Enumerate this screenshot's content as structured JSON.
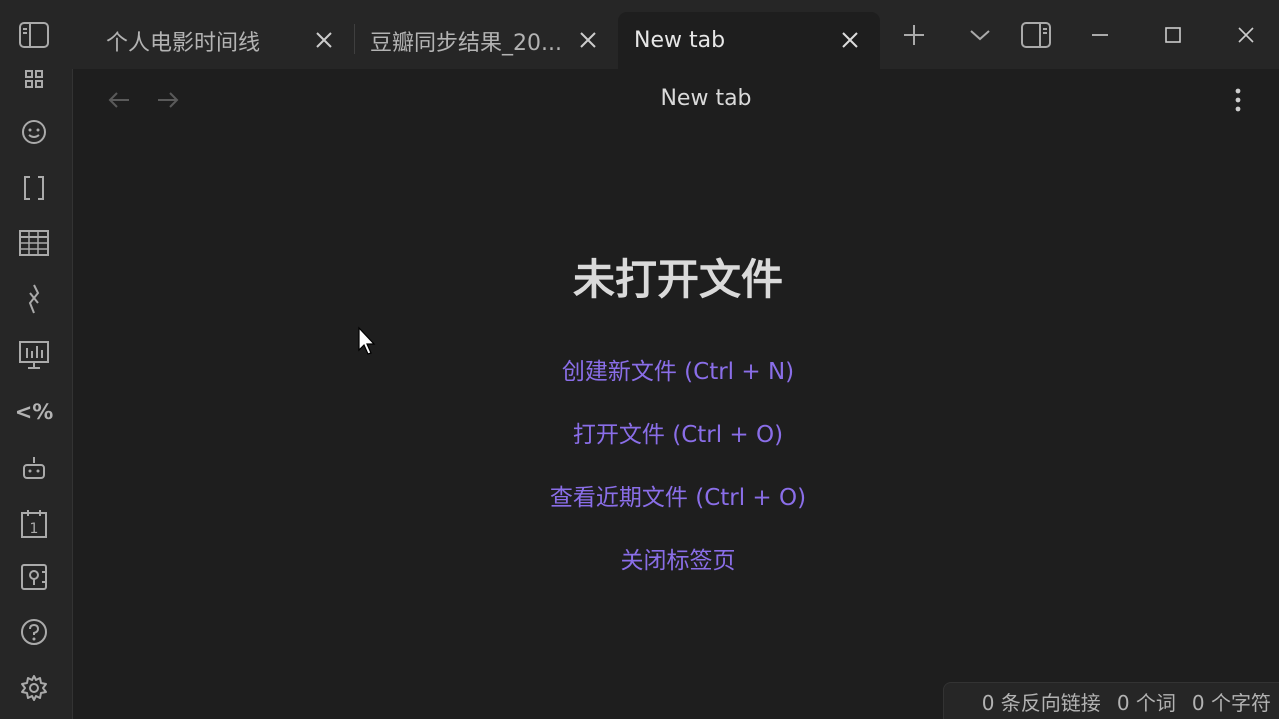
{
  "tabs": [
    {
      "label": "个人电影时间线"
    },
    {
      "label": "豆瓣同步结果_20..."
    },
    {
      "label": "New tab",
      "active": true
    }
  ],
  "titlebar": {
    "new_tab_icon": "plus-icon",
    "tab_list_icon": "chevron-down-icon",
    "right_sidebar_icon": "right-sidebar-toggle-icon",
    "minimize_icon": "minimize-icon",
    "maximize_icon": "maximize-icon",
    "close_icon": "close-icon"
  },
  "ribbon": {
    "items": [
      {
        "icon": "graph-icon"
      },
      {
        "icon": "smiley-icon"
      },
      {
        "icon": "brackets-icon"
      },
      {
        "icon": "table-icon"
      },
      {
        "icon": "excalidraw-pen-icon"
      },
      {
        "icon": "presentation-chart-icon"
      },
      {
        "icon": "templater-icon",
        "text": "<%"
      },
      {
        "icon": "bot-icon"
      },
      {
        "icon": "calendar-icon",
        "text": "1"
      },
      {
        "icon": "vault-icon"
      },
      {
        "icon": "help-icon"
      },
      {
        "icon": "settings-icon"
      }
    ]
  },
  "view": {
    "title": "New tab",
    "empty_title": "未打开文件",
    "actions": [
      {
        "label": "创建新文件 (Ctrl + N)"
      },
      {
        "label": "打开文件 (Ctrl + O)"
      },
      {
        "label": "查看近期文件 (Ctrl + O)"
      },
      {
        "label": "关闭标签页"
      }
    ]
  },
  "status": {
    "backlinks": "0 条反向链接",
    "words": "0 个词",
    "chars": "0 个字符"
  },
  "colors": {
    "accent": "#8a6ee8",
    "background": "#1e1e1e",
    "chrome": "#262626"
  }
}
